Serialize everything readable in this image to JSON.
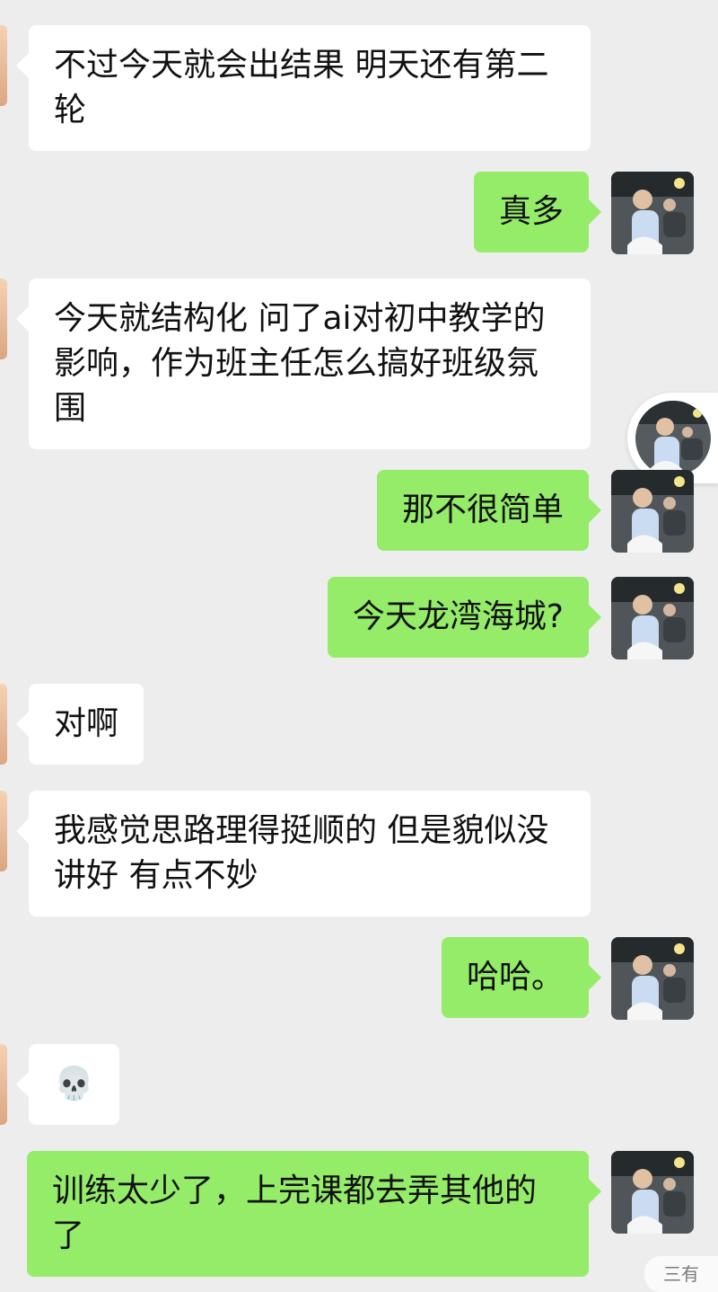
{
  "conversation": {
    "messages": [
      {
        "side": "left",
        "text": "不过今天就会出结果 明天还有第二轮"
      },
      {
        "side": "right",
        "text": "真多"
      },
      {
        "side": "left",
        "text": "今天就结构化 问了ai对初中教学的影响，作为班主任怎么搞好班级氛围"
      },
      {
        "side": "right",
        "text": "那不很简单"
      },
      {
        "side": "right",
        "text": "今天龙湾海城?"
      },
      {
        "side": "left",
        "text": "对啊"
      },
      {
        "side": "left",
        "text": "我感觉思路理得挺顺的 但是貌似没讲好 有点不妙"
      },
      {
        "side": "right",
        "text": "哈哈。"
      },
      {
        "side": "left",
        "text": "💀"
      },
      {
        "side": "right",
        "text": "训练太少了，上完课都去弄其他的了"
      }
    ]
  },
  "watermark": {
    "text": "三有"
  },
  "colors": {
    "background": "#ededed",
    "incoming_bubble": "#ffffff",
    "outgoing_bubble": "#95ec69"
  },
  "icons": {
    "contact_avatar": "photo-avatar",
    "floating_avatar": "photo-avatar"
  }
}
